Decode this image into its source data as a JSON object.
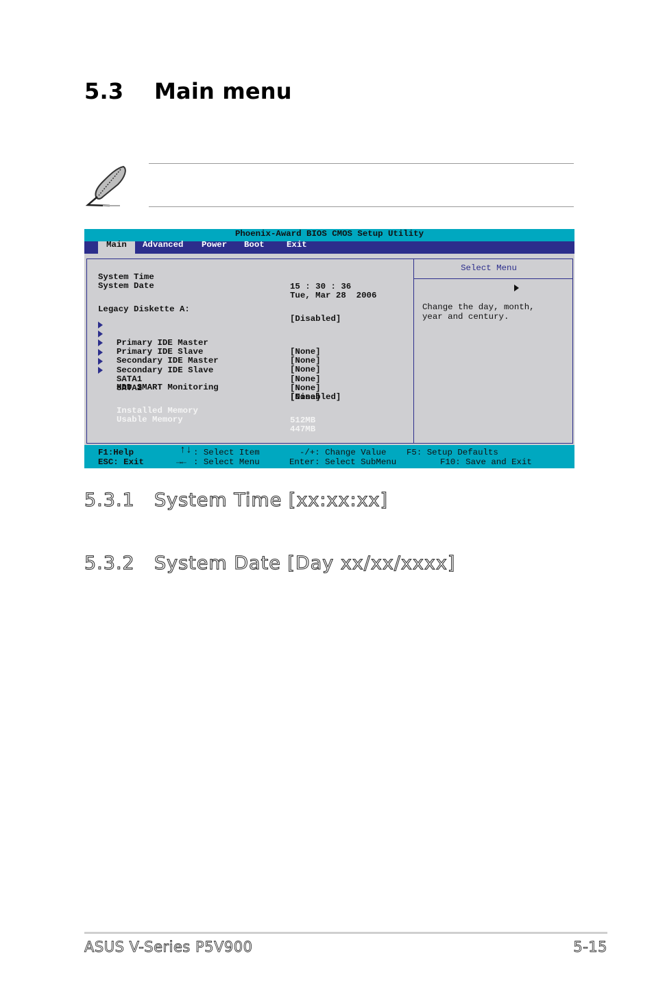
{
  "section": {
    "number": "5.3",
    "title": "Main menu"
  },
  "note": {
    "icon": "feather-pen-icon",
    "text": ""
  },
  "bios": {
    "title": "Phoenix-Award BIOS CMOS Setup Utility",
    "tabs": [
      {
        "label": "Main",
        "active": true
      },
      {
        "label": "Advanced",
        "active": false
      },
      {
        "label": "Power",
        "active": false
      },
      {
        "label": "Boot",
        "active": false
      },
      {
        "label": "Exit",
        "active": false
      }
    ],
    "items": [
      {
        "label": "System Time",
        "value": "15 : 30 : 36"
      },
      {
        "label": "System Date",
        "value": "Tue, Mar 28  2006"
      },
      {
        "label": "Legacy Diskette A:",
        "value": "[Disabled]"
      },
      {
        "label": "Primary IDE Master",
        "value": "[None]",
        "submenu": true
      },
      {
        "label": "Primary IDE Slave",
        "value": "[None]",
        "submenu": true
      },
      {
        "label": "Secondary IDE Master",
        "value": "[None]",
        "submenu": true
      },
      {
        "label": "Secondary IDE Slave",
        "value": "[None]",
        "submenu": true
      },
      {
        "label": "SATA1",
        "value": "[None]",
        "submenu": true
      },
      {
        "label": "SATA2",
        "value": "[None]",
        "submenu": true
      },
      {
        "label": "HDD SMART Monitoring",
        "value": "[Disabled]"
      },
      {
        "label": "Installed Memory",
        "value": "512MB",
        "readonly": true
      },
      {
        "label": "Usable Memory",
        "value": "447MB",
        "readonly": true
      }
    ],
    "help": {
      "title": "Select Menu",
      "text": "Change the day, month,\nyear and century."
    },
    "footer": {
      "f1": "F1:Help",
      "esc": "ESC: Exit",
      "updown_icon": "↑↓",
      "updown": ": Select Item",
      "leftright_icon": "→←",
      "leftright": ": Select Menu",
      "change": "-/+: Change Value",
      "enter": "Enter: Select SubMenu",
      "f5": "F5: Setup Defaults",
      "f10": "F10: Save and Exit"
    },
    "colors": {
      "title_bar": "#00a8c0",
      "tab_bar": "#2c2e8c",
      "panel": "#cfcfd2"
    }
  },
  "subsections": [
    {
      "number": "5.3.1",
      "title": "System Time [xx:xx:xx]"
    },
    {
      "number": "5.3.2",
      "title": "System Date [Day xx/xx/xxxx]"
    }
  ],
  "page_footer": {
    "product": "ASUS V-Series P5V900",
    "page": "5-15"
  }
}
